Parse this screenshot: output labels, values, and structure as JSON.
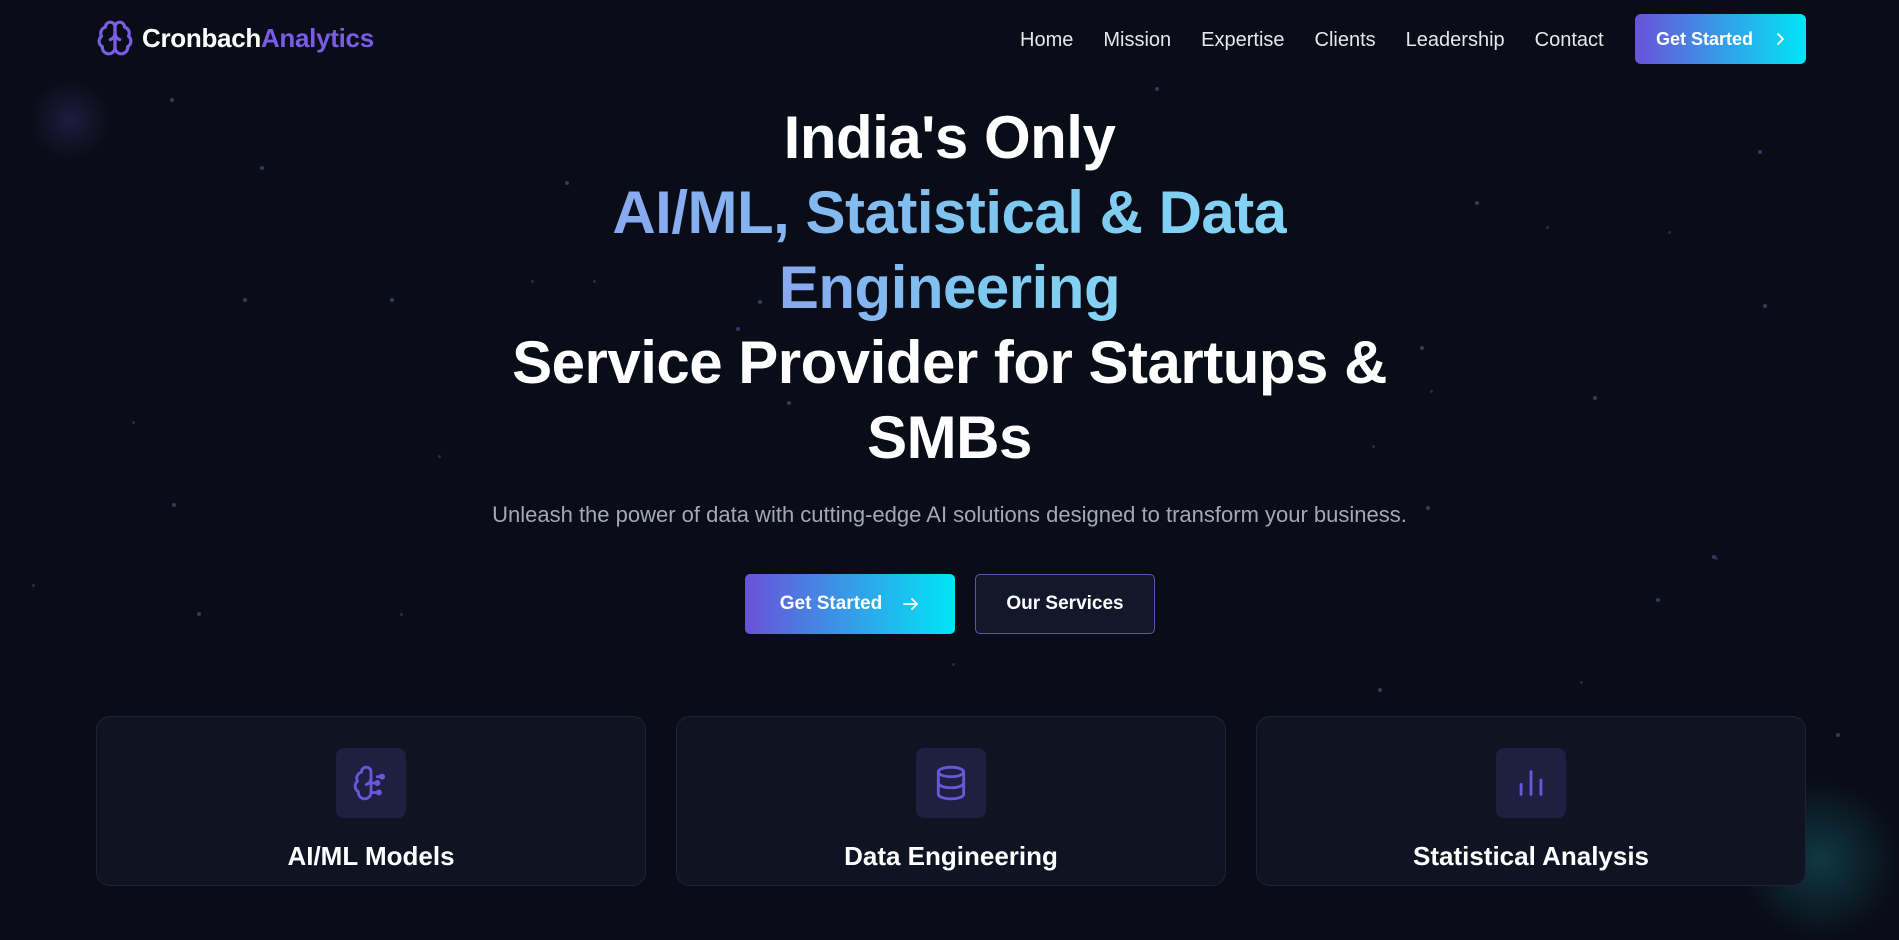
{
  "brand": {
    "name_part1": "Cronbach",
    "name_part2": "Analytics"
  },
  "nav": {
    "links": [
      "Home",
      "Mission",
      "Expertise",
      "Clients",
      "Leadership",
      "Contact"
    ],
    "cta_label": "Get Started"
  },
  "hero": {
    "line1": "India's Only",
    "line2": "AI/ML, Statistical & Data",
    "line3": "Engineering",
    "line4": "Service Provider for Startups &",
    "line5": "SMBs",
    "subtitle": "Unleash the power of data with cutting-edge AI solutions designed to transform your business.",
    "primary_button": "Get Started",
    "secondary_button": "Our Services"
  },
  "services": [
    {
      "title": "AI/ML Models",
      "icon": "brain-icon"
    },
    {
      "title": "Data Engineering",
      "icon": "database-icon"
    },
    {
      "title": "Statistical Analysis",
      "icon": "bar-chart-icon"
    }
  ],
  "colors": {
    "background": "#0a0d17",
    "accent_purple": "#7a5ce6",
    "accent_cyan": "#00e6f7",
    "card_bg": "#0f1322"
  }
}
